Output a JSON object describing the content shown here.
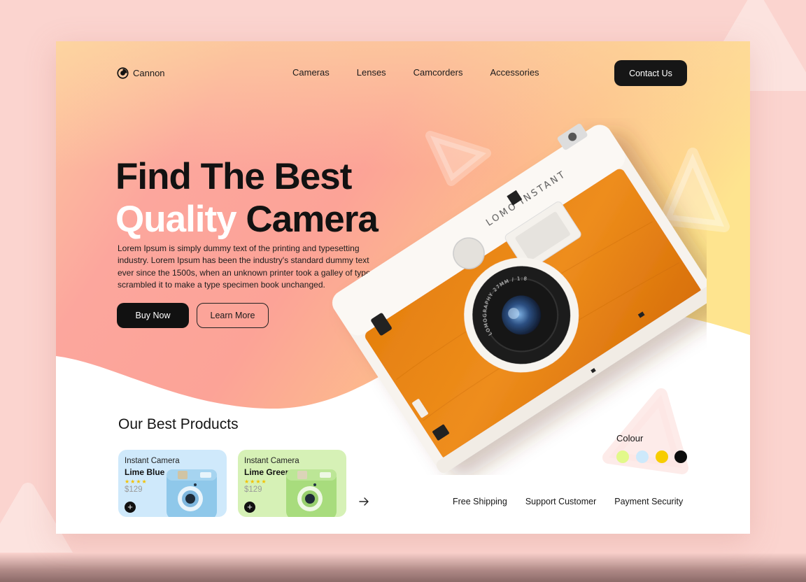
{
  "brand": {
    "name": "Cannon"
  },
  "nav": {
    "items": [
      "Cameras",
      "Lenses",
      "Camcorders",
      "Accessories"
    ],
    "contact_label": "Contact Us"
  },
  "hero": {
    "headline_line1": "Find The Best",
    "headline_word_highlight": "Quality",
    "headline_word_rest": "Camera",
    "description": "Lorem Ipsum is simply dummy text of the printing and typesetting industry. Lorem Ipsum has been the industry's standard dummy text ever since the 1500s, when an unknown printer took a galley of type and scrambled it to make a type specimen book unchanged.",
    "buy_label": "Buy Now",
    "learn_label": "Learn More",
    "camera_brand_text": "LOMO'INSTANT",
    "lens_ring_text": "LOMOGRAPHY 27MM / 1:8"
  },
  "products": {
    "title": "Our Best Products",
    "items": [
      {
        "type": "Instant Camera",
        "name": "Lime Blue",
        "stars": "★★★★",
        "price": "$129",
        "add": "+"
      },
      {
        "type": "Instant Camera",
        "name": "Lime Green",
        "stars": "★★★★",
        "price": "$129",
        "add": "+"
      }
    ],
    "next_icon": "arrow-right-icon"
  },
  "colour": {
    "label": "Colour",
    "swatches": [
      "#e2f98a",
      "#cde9fb",
      "#f7cd00",
      "#0d0d0d"
    ]
  },
  "features": [
    "Free Shipping",
    "Support Customer",
    "Payment Security"
  ],
  "colors": {
    "accent_dark": "#161616",
    "camera_orange": "#e8841a",
    "hero_pink": "#fba09a",
    "hero_yellow": "#fde58a"
  }
}
